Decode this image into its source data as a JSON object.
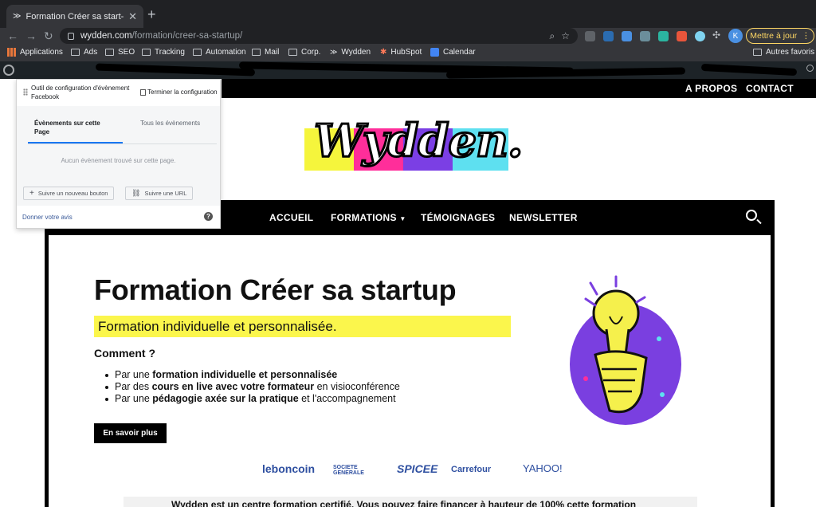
{
  "browser": {
    "tab_title": "Formation Créer sa start-up | W",
    "url_host": "wydden.com",
    "url_path": "/formation/creer-sa-startup/",
    "avatar_letter": "K",
    "update_label": "Mettre à jour"
  },
  "bookmarks": [
    {
      "label": "Applications",
      "icon": "grid-icon"
    },
    {
      "label": "Ads",
      "icon": "folder-icon"
    },
    {
      "label": "SEO",
      "icon": "folder-icon"
    },
    {
      "label": "Tracking",
      "icon": "folder-icon"
    },
    {
      "label": "Automation",
      "icon": "folder-icon"
    },
    {
      "label": "Mail",
      "icon": "folder-icon"
    },
    {
      "label": "Corp.",
      "icon": "folder-icon"
    },
    {
      "label": "Wydden",
      "icon": "wydden-icon"
    },
    {
      "label": "HubSpot",
      "icon": "hubspot-icon"
    },
    {
      "label": "Calendar",
      "icon": "calendar-icon"
    },
    {
      "label": "Autres favoris",
      "icon": "folder-icon"
    }
  ],
  "site": {
    "top_nav": [
      "A PROPOS",
      "CONTACT"
    ],
    "logo_text": "Wydden.",
    "main_nav": [
      "ACCUEIL",
      "FORMATIONS",
      "TÉMOIGNAGES",
      "NEWSLETTER"
    ],
    "hero": {
      "title": "Formation Créer sa startup",
      "subtitle": "Formation individuelle et personnalisée.",
      "comment_heading": "Comment ?",
      "bullets": [
        {
          "pre": "Par une ",
          "bold": "formation individuelle et personnalisée",
          "post": ""
        },
        {
          "pre": "Par des ",
          "bold": "cours en live avec votre formateur",
          "post": " en visioconférence"
        },
        {
          "pre": "Par une ",
          "bold": "pédagogie axée sur la pratique",
          "post": " et l'accompagnement"
        }
      ],
      "cta_label": "En savoir plus"
    },
    "partners": [
      "leboncoin",
      "SOCIETE GENERALE",
      "SPICEE",
      "Carrefour",
      "YAHOO!"
    ],
    "bottom_banner": "Wydden est un centre formation certifié. Vous pouvez faire financer à hauteur de 100% cette formation"
  },
  "fb_tool": {
    "title": "Outil de configuration d'évènement Facebook",
    "finish_label": "Terminer la configuration",
    "tab_active": "Évènements sur cette Page",
    "tab_inactive": "Tous les évènements",
    "empty_text": "Aucun évènement trouvé sur cette page.",
    "btn_follow_button": "Suivre un nouveau bouton",
    "btn_follow_url": "Suivre une URL",
    "feedback_link": "Donner votre avis"
  },
  "colors": {
    "highlight": "#fbf64c",
    "logo_yellow": "#f5f53c",
    "logo_pink": "#ff2e9a",
    "logo_purple": "#7b3fe4",
    "logo_cyan": "#5ee0f0",
    "illus_purple": "#7a3fe0",
    "fb_blue": "#1877f2"
  }
}
